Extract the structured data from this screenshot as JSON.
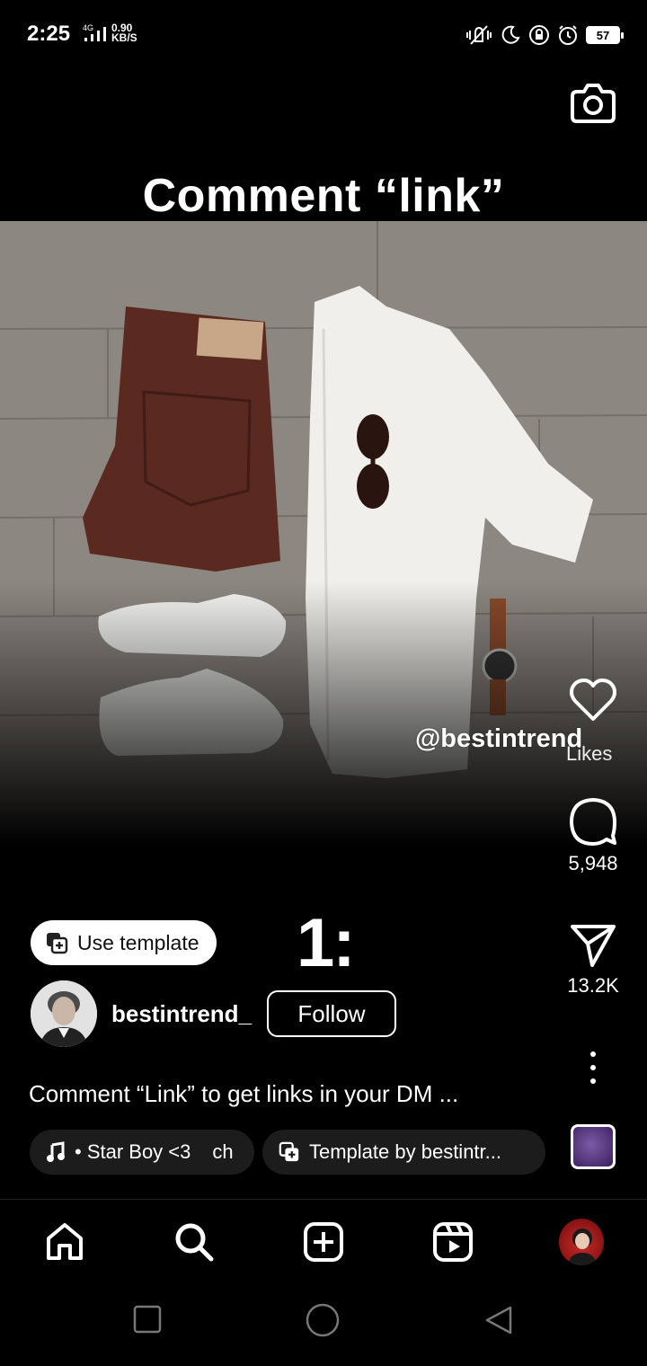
{
  "status_bar": {
    "time": "2:25",
    "network": "4G",
    "speed_value": "0.90",
    "speed_unit": "KB/S",
    "battery": "57"
  },
  "post": {
    "overlay_title": "Comment “link”",
    "watermark": "@bestintrend",
    "counter_text": "1:",
    "use_template_label": "Use template",
    "username": "bestintrend_",
    "follow_label": "Follow",
    "caption": "Comment “Link” to get links in your DM ...",
    "music_label": "• Star Boy <3",
    "music_label_tail": "ch",
    "template_credit": "Template by bestintr..."
  },
  "actions": {
    "likes_label": "Likes",
    "comments_count": "5,948",
    "shares_count": "13.2K"
  },
  "icons": {
    "camera": "camera-icon",
    "like": "heart-icon",
    "comment": "comment-icon",
    "share": "send-icon",
    "more": "more-vertical-icon",
    "music": "music-note-icon",
    "template": "template-icon",
    "nav": [
      "home-icon",
      "search-icon",
      "create-icon",
      "reels-icon",
      "profile-avatar"
    ],
    "system": [
      "recents-icon",
      "home-circle-icon",
      "back-icon"
    ]
  }
}
